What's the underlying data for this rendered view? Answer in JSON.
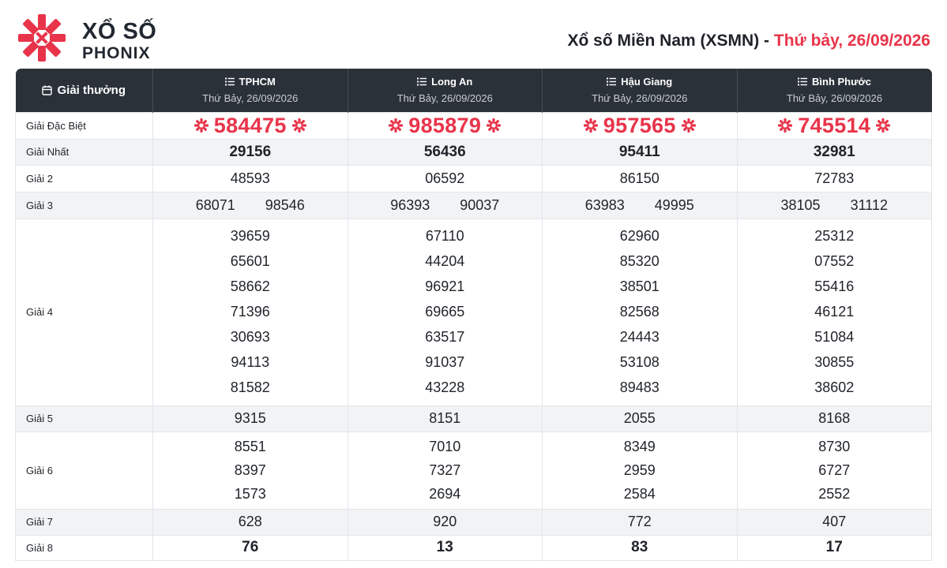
{
  "brand": {
    "line1": "XỔ SỐ",
    "line2": "PHONIX",
    "accent": "#e8344a",
    "icon": "asterisk-logo-icon"
  },
  "page_title": {
    "main": "Xổ số Miền Nam (XSMN)",
    "separator": "-",
    "date": "Thứ bảy, 26/09/2026"
  },
  "table": {
    "header_label": "Giải thưởng",
    "provinces": [
      {
        "name": "TPHCM",
        "date": "Thứ Bảy, 26/09/2026"
      },
      {
        "name": "Long An",
        "date": "Thứ Bảy, 26/09/2026"
      },
      {
        "name": "Hậu Giang",
        "date": "Thứ Bảy, 26/09/2026"
      },
      {
        "name": "Bình Phước",
        "date": "Thứ Bảy, 26/09/2026"
      }
    ],
    "labels": {
      "db": "Giải Đặc Biệt",
      "n1": "Giải Nhất",
      "n2": "Giải 2",
      "n3": "Giải 3",
      "n4": "Giải 4",
      "n5": "Giải 5",
      "n6": "Giải 6",
      "n7": "Giải 7",
      "n8": "Giải 8"
    },
    "results": [
      {
        "db": "584475",
        "n1": "29156",
        "n2": "48593",
        "n3": [
          "68071",
          "98546"
        ],
        "n4": [
          "39659",
          "65601",
          "58662",
          "71396",
          "30693",
          "94113",
          "81582"
        ],
        "n5": "9315",
        "n6": [
          "8551",
          "8397",
          "1573"
        ],
        "n7": "628",
        "n8": "76"
      },
      {
        "db": "985879",
        "n1": "56436",
        "n2": "06592",
        "n3": [
          "96393",
          "90037"
        ],
        "n4": [
          "67110",
          "44204",
          "96921",
          "69665",
          "63517",
          "91037",
          "43228"
        ],
        "n5": "8151",
        "n6": [
          "7010",
          "7327",
          "2694"
        ],
        "n7": "920",
        "n8": "13"
      },
      {
        "db": "957565",
        "n1": "95411",
        "n2": "86150",
        "n3": [
          "63983",
          "49995"
        ],
        "n4": [
          "62960",
          "85320",
          "38501",
          "82568",
          "24443",
          "53108",
          "89483"
        ],
        "n5": "2055",
        "n6": [
          "8349",
          "2959",
          "2584"
        ],
        "n7": "772",
        "n8": "83"
      },
      {
        "db": "745514",
        "n1": "32981",
        "n2": "72783",
        "n3": [
          "38105",
          "31112"
        ],
        "n4": [
          "25312",
          "07552",
          "55416",
          "46121",
          "51084",
          "30855",
          "38602"
        ],
        "n5": "8168",
        "n6": [
          "8730",
          "6727",
          "2552"
        ],
        "n7": "407",
        "n8": "17"
      }
    ]
  },
  "colors": {
    "header_bg": "#2b3139",
    "accent": "#e8344a",
    "row_shade": "#f2f3f5",
    "border": "#e2e5e9"
  }
}
